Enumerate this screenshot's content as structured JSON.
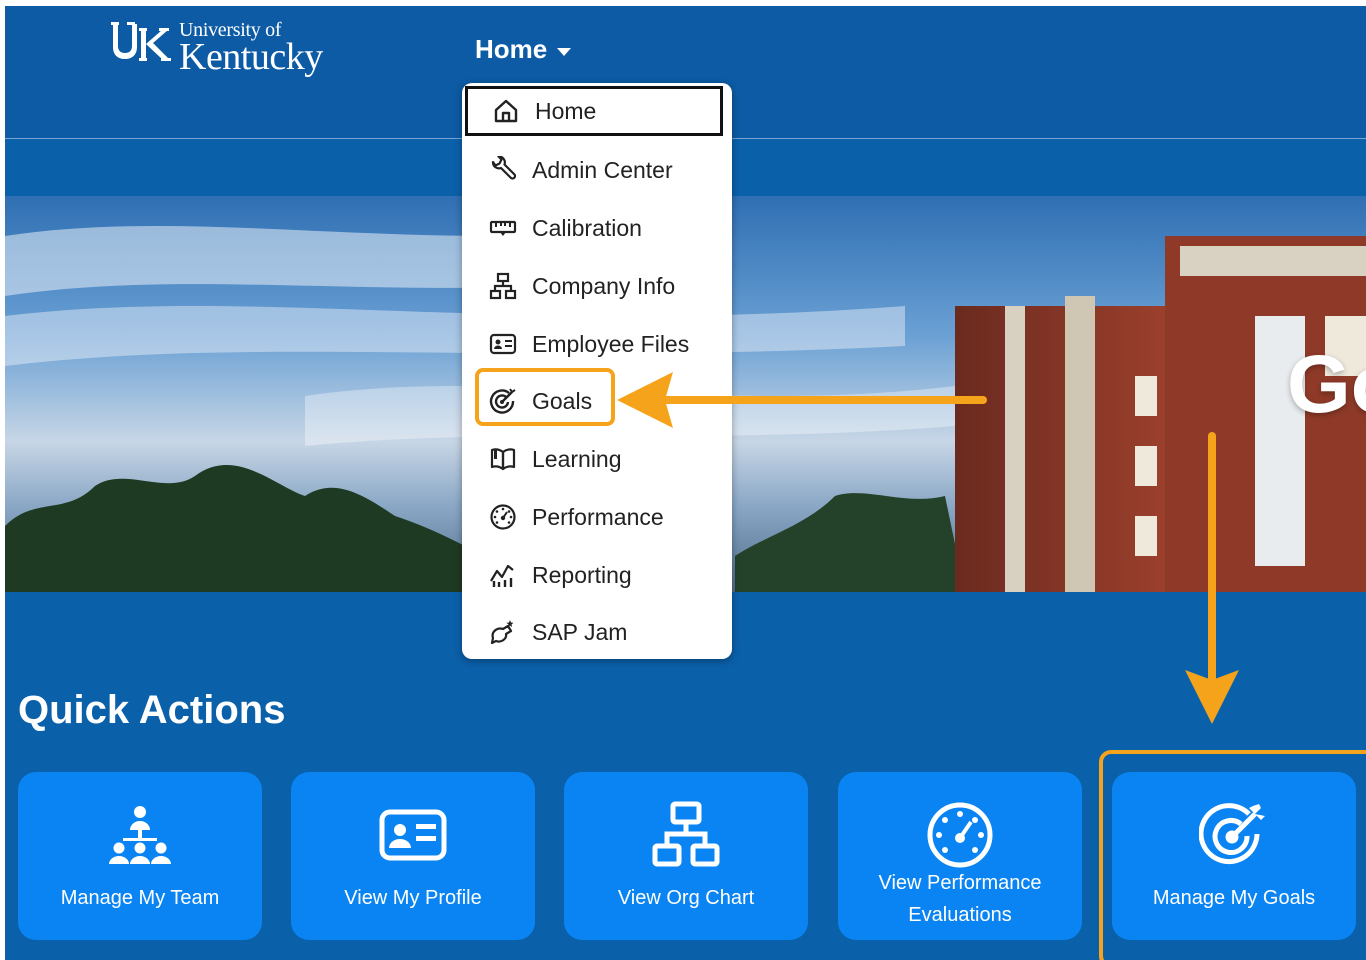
{
  "header": {
    "logo": {
      "line1": "University of",
      "line2": "Kentucky"
    },
    "nav_home_label": "Home"
  },
  "hero": {
    "title_partial": "Go"
  },
  "dropdown": {
    "items": [
      {
        "label": "Home",
        "icon": "home-icon",
        "selected": true
      },
      {
        "label": "Admin Center",
        "icon": "wrench-icon"
      },
      {
        "label": "Calibration",
        "icon": "calibration-icon"
      },
      {
        "label": "Company Info",
        "icon": "org-chart-icon"
      },
      {
        "label": "Employee Files",
        "icon": "id-card-icon"
      },
      {
        "label": "Goals",
        "icon": "target-icon",
        "highlighted": true
      },
      {
        "label": "Learning",
        "icon": "book-icon"
      },
      {
        "label": "Performance",
        "icon": "gauge-icon"
      },
      {
        "label": "Reporting",
        "icon": "chart-icon"
      },
      {
        "label": "SAP Jam",
        "icon": "collaboration-icon"
      }
    ]
  },
  "quick_actions": {
    "title": "Quick Actions",
    "tiles": [
      {
        "label": "Manage My Team",
        "icon": "team-icon"
      },
      {
        "label": "View My Profile",
        "icon": "id-card-icon"
      },
      {
        "label": "View Org Chart",
        "icon": "org-chart-icon"
      },
      {
        "label": "View Performance Evaluations",
        "icon": "gauge-icon"
      },
      {
        "label": "Manage My Goals",
        "icon": "target-icon",
        "highlighted": true
      }
    ]
  },
  "colors": {
    "background": "#0b60aa",
    "header": "#0d5ba4",
    "tile": "#0a84f2",
    "annotation": "#f5a31a",
    "menu_bg": "#ffffff"
  }
}
